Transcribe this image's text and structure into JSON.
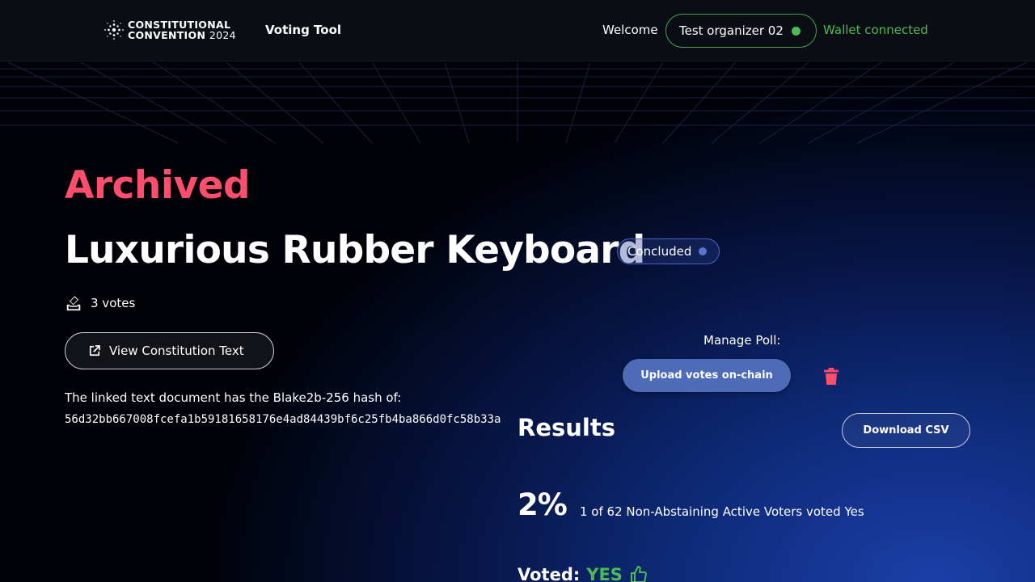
{
  "header": {
    "logo_line1": "CONSTITUTIONAL",
    "logo_line2": "CONVENTION",
    "logo_year": "2024",
    "nav_title": "Voting Tool",
    "welcome": "Welcome",
    "user_name": "Test organizer 02",
    "wallet_status": "Wallet connected"
  },
  "poll": {
    "archive_status": "Archived",
    "title": "Luxurious Rubber Keyboard",
    "status_badge": "Concluded",
    "votes_count": "3 votes",
    "view_button": "View Constitution Text",
    "hash_label": "The linked text document has the Blake2b-256 hash of:",
    "hash_value": "56d32bb667008fcefa1b59181658176e4ad84439bf6c25fb4ba866d0fc58b33a"
  },
  "manage": {
    "label": "Manage Poll:",
    "upload_button": "Upload votes on-chain"
  },
  "results": {
    "title": "Results",
    "download_button": "Download CSV",
    "percentage": "2%",
    "description": "1 of 62 Non-Abstaining Active Voters voted Yes",
    "voted_label": "Voted:",
    "voted_answer": "YES"
  },
  "colors": {
    "accent_red": "#ff4d6d",
    "accent_green": "#4cbb53",
    "button_blue": "#4e6bb8"
  },
  "icons": [
    "logo-icon",
    "ballot-box-icon",
    "external-link-icon",
    "trash-icon",
    "thumbs-up-icon"
  ]
}
